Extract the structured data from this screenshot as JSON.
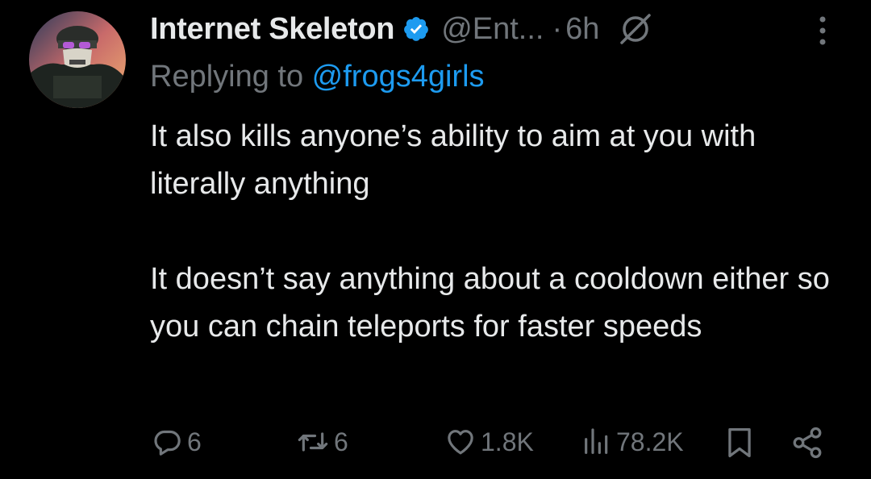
{
  "tweet": {
    "author": {
      "display_name": "Internet Skeleton",
      "handle": "@Ent...",
      "verified": true
    },
    "separator": "·",
    "time": "6h",
    "replying_prefix": "Replying to ",
    "replying_to": "@frogs4girls",
    "paragraphs": [
      "It also kills anyone’s ability to aim at you with literally anything",
      "It doesn’t say anything about a cooldown either so you can chain teleports for faster speeds"
    ],
    "stats": {
      "replies": "6",
      "reposts": "6",
      "likes": "1.8K",
      "views": "78.2K"
    }
  },
  "colors": {
    "background": "#000000",
    "text": "#e7e9ea",
    "secondary": "#71767b",
    "accent": "#1d9bf0"
  },
  "icons": [
    "verified-badge-icon",
    "muted-icon",
    "more-icon",
    "reply-icon",
    "repost-icon",
    "like-icon",
    "views-icon",
    "bookmark-icon",
    "share-icon"
  ]
}
